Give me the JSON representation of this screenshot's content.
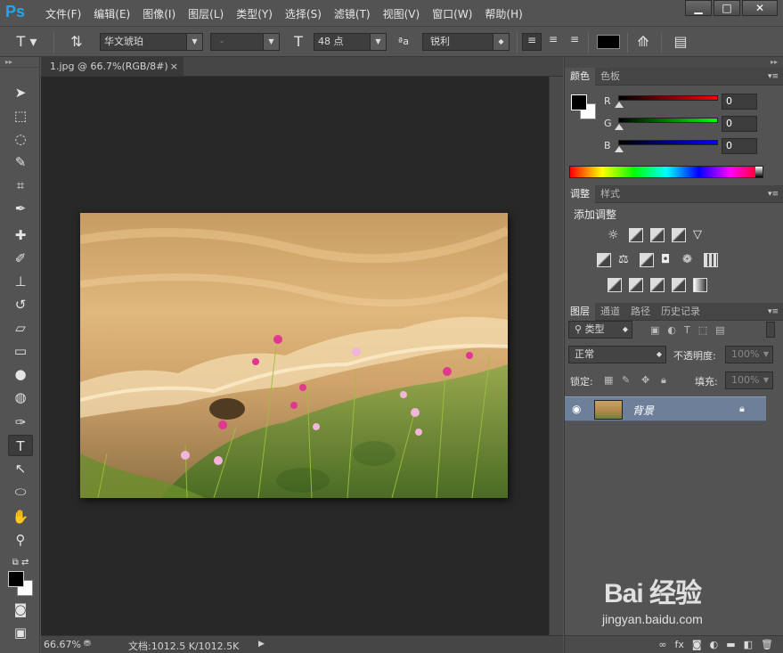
{
  "app": {
    "logo": "Ps"
  },
  "menu": [
    "文件(F)",
    "编辑(E)",
    "图像(I)",
    "图层(L)",
    "类型(Y)",
    "选择(S)",
    "滤镜(T)",
    "视图(V)",
    "窗口(W)",
    "帮助(H)"
  ],
  "window_buttons": {
    "minimize": "▁",
    "maximize": "□",
    "close": "✕"
  },
  "options": {
    "font_family": "华文琥珀",
    "font_style": "-",
    "font_size": "48 点",
    "aa_label": "ªa",
    "antialias": "锐利",
    "color_hex": "#000000"
  },
  "document": {
    "tab_title": "1.jpg @ 66.7%(RGB/8#)",
    "tab_close": "×",
    "zoom": "66.67%",
    "doc_info": "文档:1012.5 K/1012.5K"
  },
  "color_panel": {
    "tabs": [
      "颜色",
      "色板"
    ],
    "channels": [
      {
        "label": "R",
        "value": "0",
        "gradient": "#ff0000"
      },
      {
        "label": "G",
        "value": "0",
        "gradient": "#00ff00"
      },
      {
        "label": "B",
        "value": "0",
        "gradient": "#0000ff"
      }
    ]
  },
  "adjust_panel": {
    "tabs": [
      "调整",
      "样式"
    ],
    "title": "添加调整"
  },
  "layers_panel": {
    "tabs": [
      "图层",
      "通道",
      "路径",
      "历史记录"
    ],
    "filter_kind": "类型",
    "blend_mode": "正常",
    "opacity_label": "不透明度:",
    "opacity_value": "100%",
    "lock_label": "锁定:",
    "fill_label": "填充:",
    "fill_value": "100%",
    "layers": [
      {
        "name": "背景",
        "visible": true,
        "locked": true
      }
    ]
  },
  "watermark": {
    "brand": "Bai 经验",
    "url": "jingyan.baidu.com"
  }
}
